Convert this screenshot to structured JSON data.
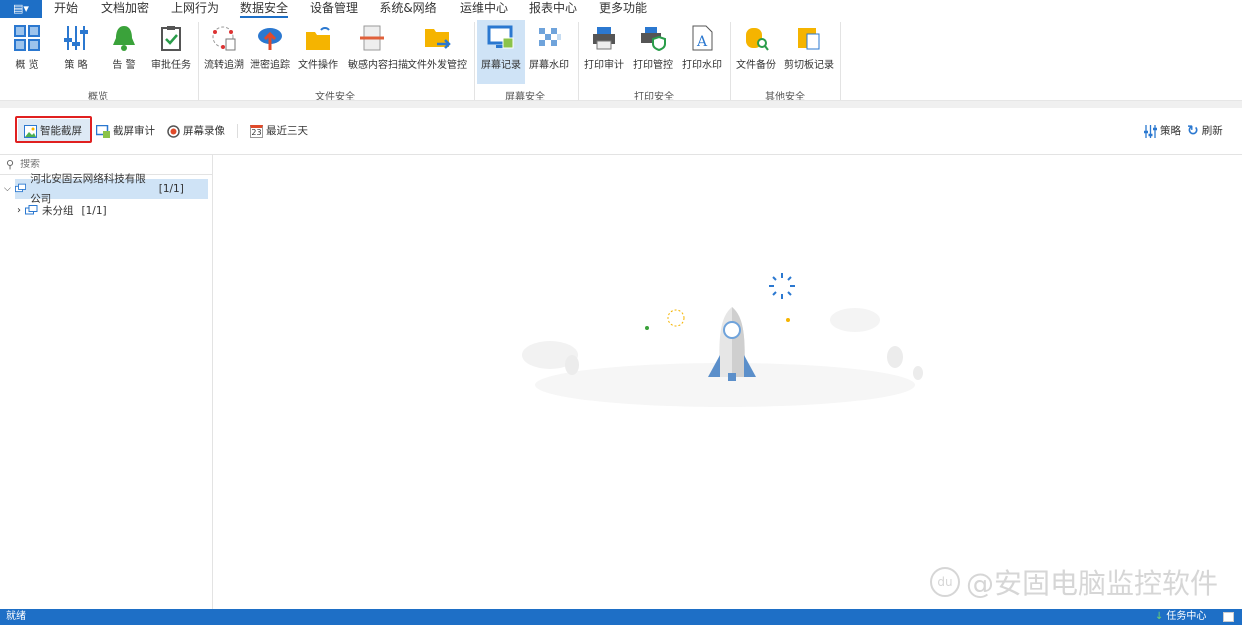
{
  "menu": {
    "tabs": [
      "开始",
      "文档加密",
      "上网行为",
      "数据安全",
      "设备管理",
      "系统&网络",
      "运维中心",
      "报表中心",
      "更多功能"
    ],
    "active": "数据安全"
  },
  "ribbon": {
    "groups": [
      "概览",
      "文件安全",
      "屏幕安全",
      "打印安全",
      "其他安全"
    ],
    "buttons": [
      "概 览",
      "策 略",
      "告 警",
      "审批任务",
      "流转追溯",
      "泄密追踪",
      "文件操作",
      "敏感内容扫描",
      "文件外发管控",
      "屏幕记录",
      "屏幕水印",
      "打印审计",
      "打印管控",
      "打印水印",
      "文件备份",
      "剪切板记录"
    ]
  },
  "toolbar": {
    "smart_screenshot": "智能截屏",
    "screenshot_audit": "截屏审计",
    "screen_recording": "屏幕录像",
    "date_range": "最近三天",
    "calendar_day": "23",
    "policy": "策略",
    "refresh": "刷新"
  },
  "sidebar": {
    "search_placeholder": "搜索",
    "tree": [
      {
        "label": "河北安固云网络科技有限公司",
        "count": "[1/1]"
      },
      {
        "label": "未分组",
        "count": "[1/1]"
      }
    ]
  },
  "status": {
    "left": "就绪",
    "task_center": "任务中心"
  },
  "watermark": {
    "text": "@安固电脑监控软件",
    "logo": "du"
  },
  "colors": {
    "accent": "#1e6fc6",
    "highlight": "#e02020",
    "selected": "#cfe3f6"
  }
}
